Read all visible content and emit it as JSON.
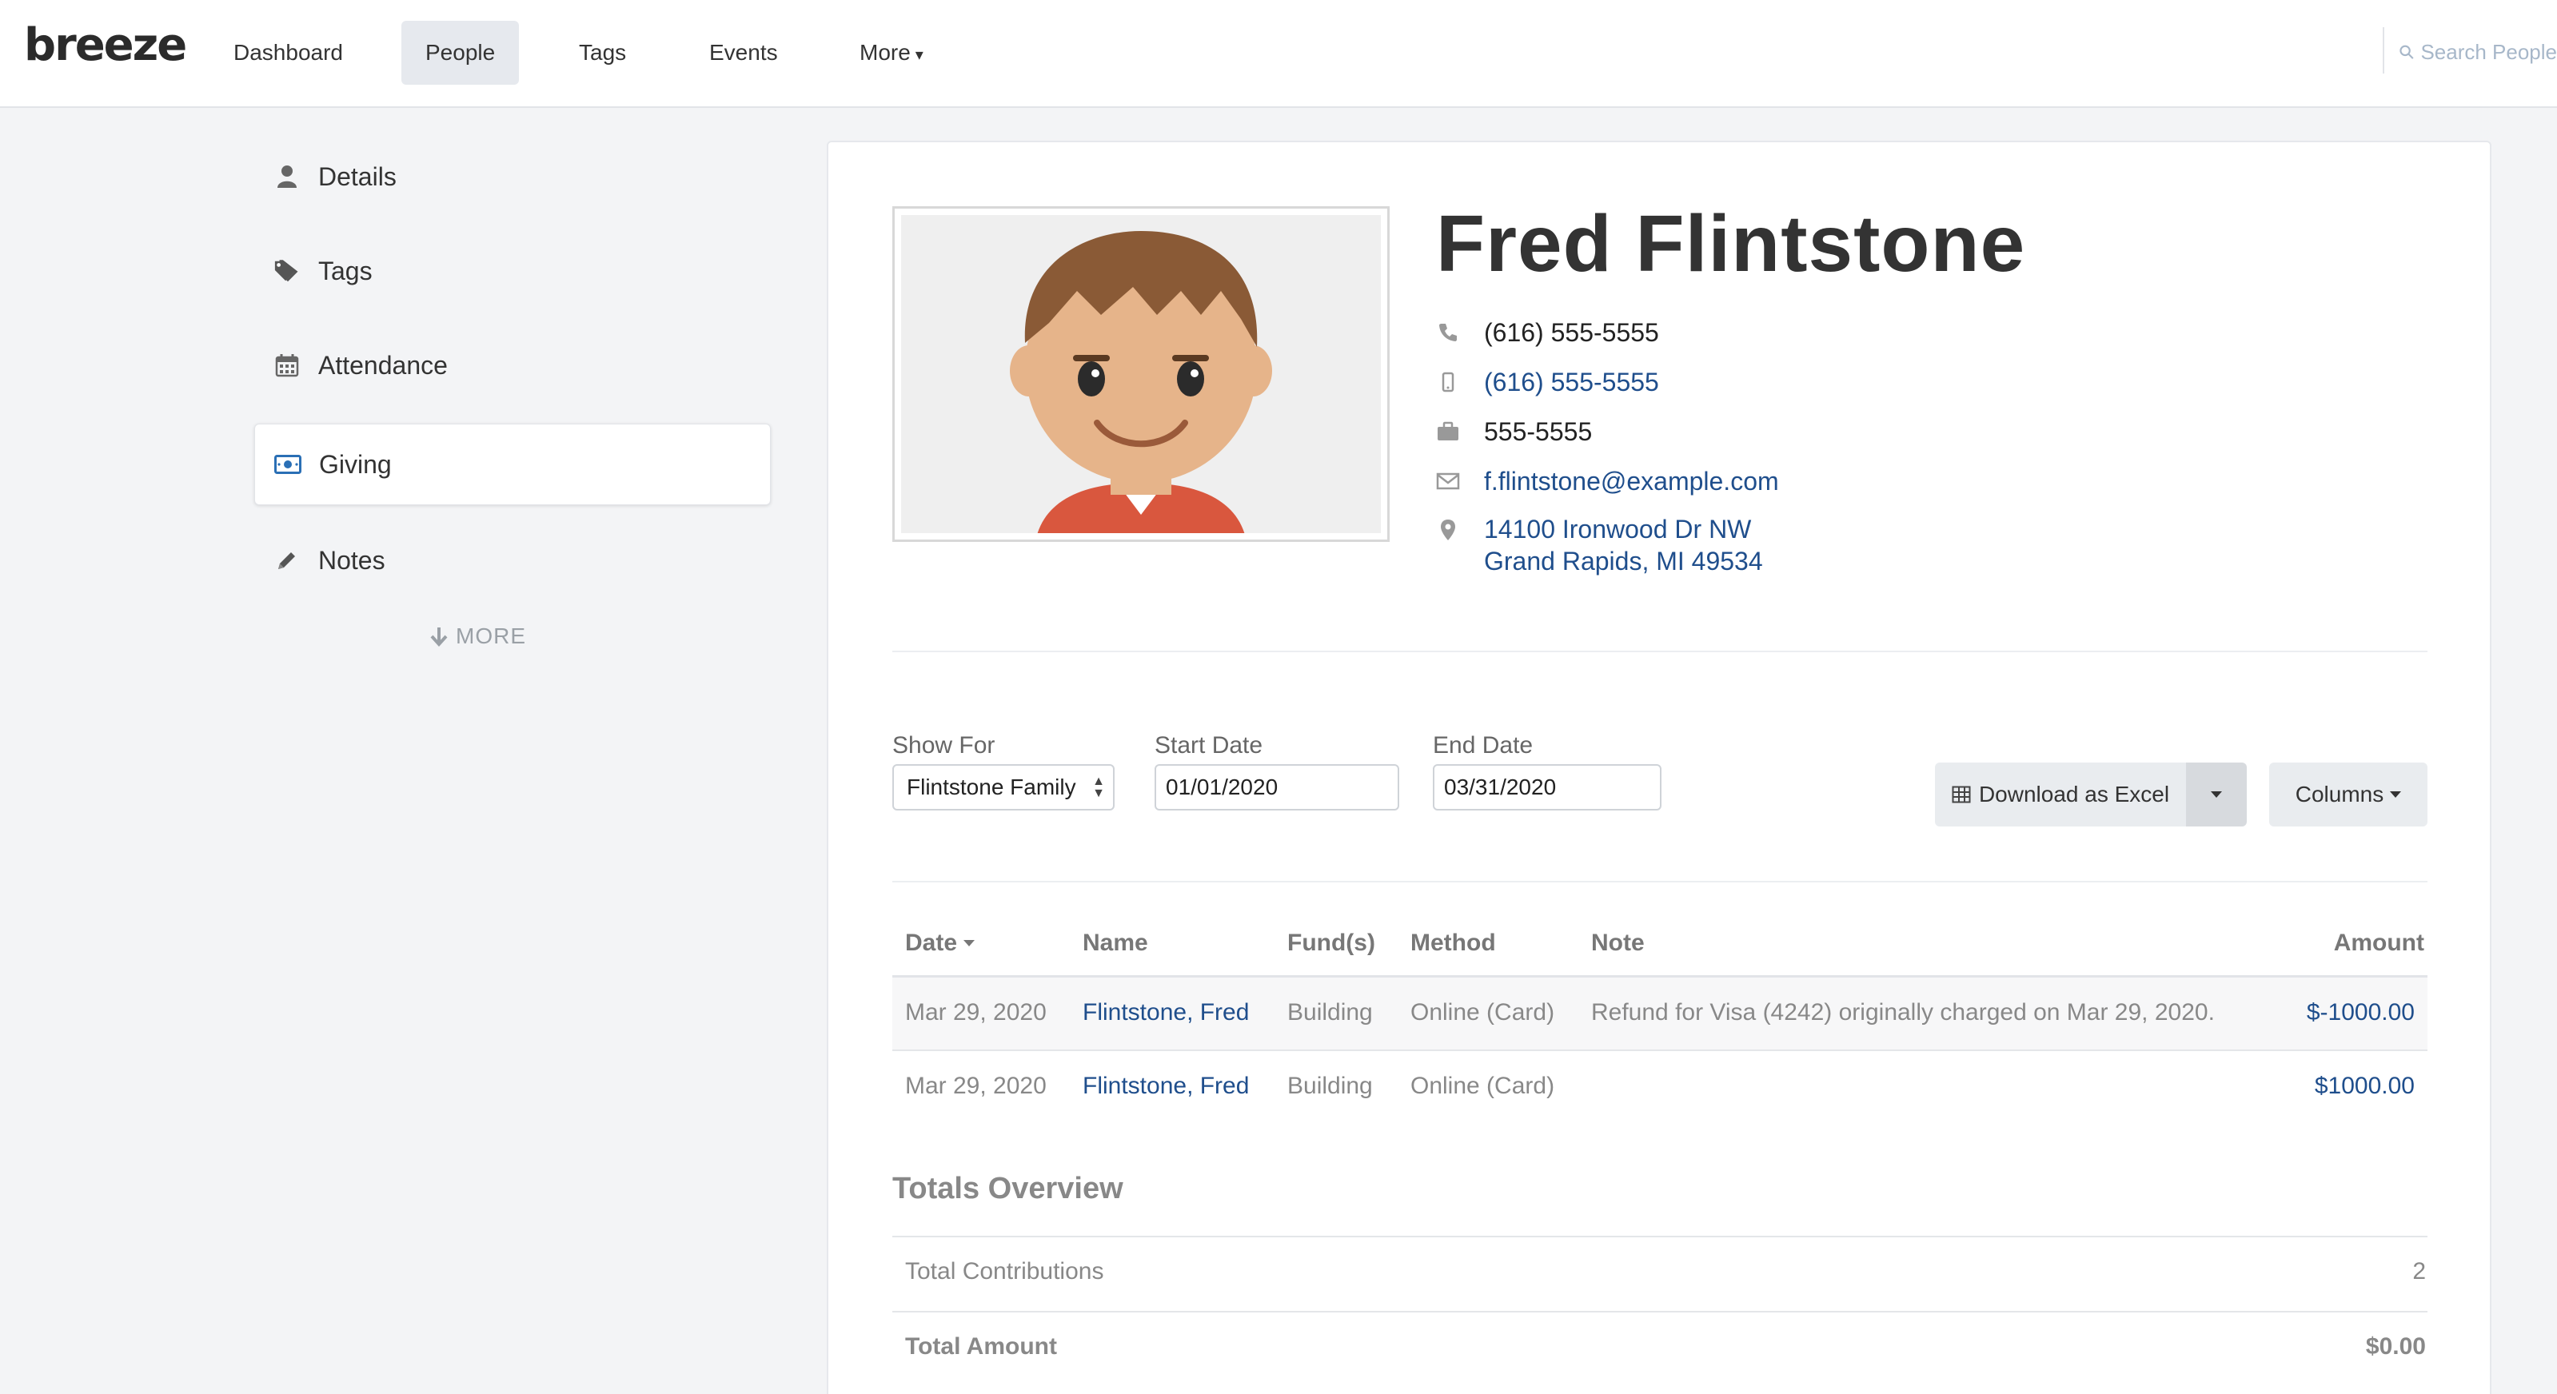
{
  "app": {
    "logo": "breeze"
  },
  "nav": {
    "items": [
      {
        "label": "Dashboard"
      },
      {
        "label": "People"
      },
      {
        "label": "Tags"
      },
      {
        "label": "Events"
      },
      {
        "label": "More"
      }
    ],
    "search_placeholder": "Search People"
  },
  "sidebar": {
    "items": [
      {
        "label": "Details",
        "icon": "person-icon"
      },
      {
        "label": "Tags",
        "icon": "tags-icon"
      },
      {
        "label": "Attendance",
        "icon": "calendar-icon"
      },
      {
        "label": "Giving",
        "icon": "money-icon"
      },
      {
        "label": "Notes",
        "icon": "pencil-icon"
      }
    ],
    "more_label": "MORE"
  },
  "profile": {
    "name": "Fred Flintstone",
    "home_phone": "(616) 555-5555",
    "mobile_phone": "(616) 555-5555",
    "work_phone": "555-5555",
    "email": "f.flintstone@example.com",
    "address_line1": "14100 Ironwood Dr NW",
    "address_line2": "Grand Rapids, MI 49534"
  },
  "filters": {
    "show_for_label": "Show For",
    "show_for_value": "Flintstone Family",
    "start_label": "Start Date",
    "start_value": "01/01/2020",
    "end_label": "End Date",
    "end_value": "03/31/2020",
    "download_label": "Download as Excel",
    "columns_label": "Columns"
  },
  "table": {
    "headers": {
      "date": "Date",
      "name": "Name",
      "funds": "Fund(s)",
      "method": "Method",
      "note": "Note",
      "amount": "Amount"
    },
    "rows": [
      {
        "date": "Mar 29, 2020",
        "name": "Flintstone, Fred",
        "funds": "Building",
        "method": "Online (Card)",
        "note": "Refund for Visa (4242) originally charged on Mar 29, 2020.",
        "amount": "$-1000.00"
      },
      {
        "date": "Mar 29, 2020",
        "name": "Flintstone, Fred",
        "funds": "Building",
        "method": "Online (Card)",
        "note": "",
        "amount": "$1000.00"
      }
    ]
  },
  "totals": {
    "title": "Totals Overview",
    "contributions_label": "Total Contributions",
    "contributions_value": "2",
    "amount_label": "Total Amount",
    "amount_value": "$0.00"
  },
  "colors": {
    "link": "#1f4e8c",
    "accent_active": "#e6e9ee",
    "muted_text": "#888888"
  }
}
